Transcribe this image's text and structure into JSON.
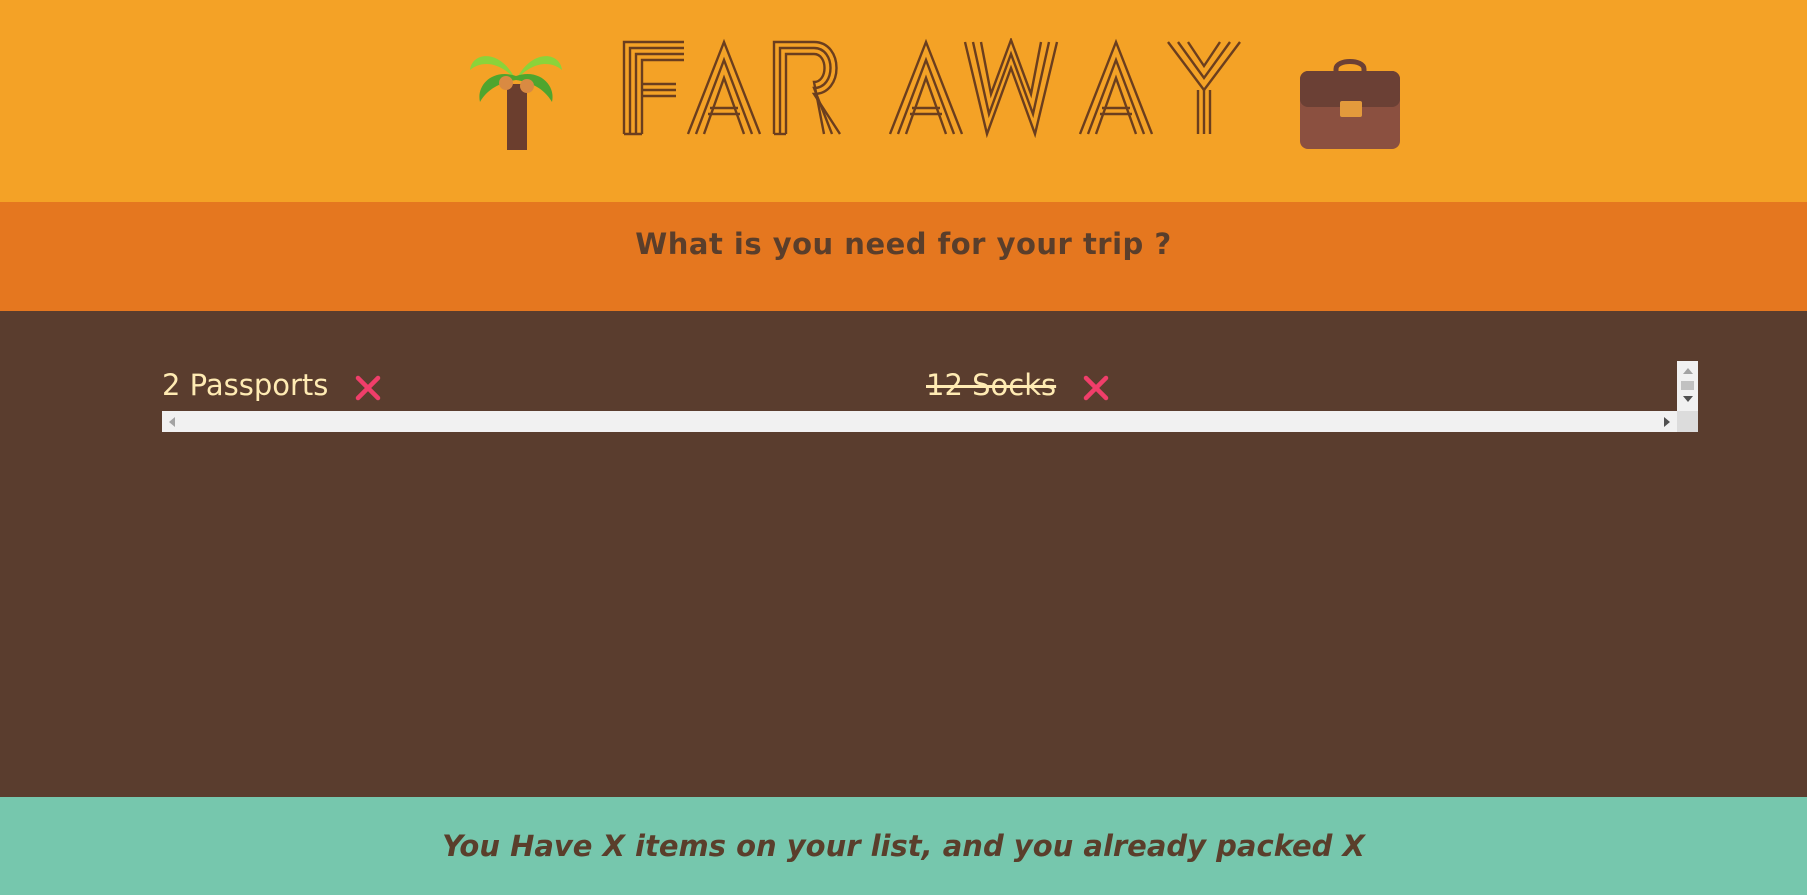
{
  "header": {
    "title": "FAR AWAY",
    "left_icon": "palm-tree-icon",
    "right_icon": "briefcase-icon"
  },
  "form": {
    "question": "What is you need for your trip ?"
  },
  "list": {
    "items": [
      {
        "label": "2 Passports",
        "packed": false,
        "remove_icon": "close-icon"
      },
      {
        "label": "12 Socks",
        "packed": true,
        "remove_icon": "close-icon"
      }
    ]
  },
  "stats": {
    "text": "You Have X items on your list, and you already packed X"
  },
  "colors": {
    "header_bg": "#f4a226",
    "form_bg": "#e5771f",
    "list_bg": "#5a3d2e",
    "stats_bg": "#76c7ad",
    "text_dark": "#5a3e2b",
    "item_text": "#ffebb3",
    "remove_red": "#f03e6a"
  }
}
